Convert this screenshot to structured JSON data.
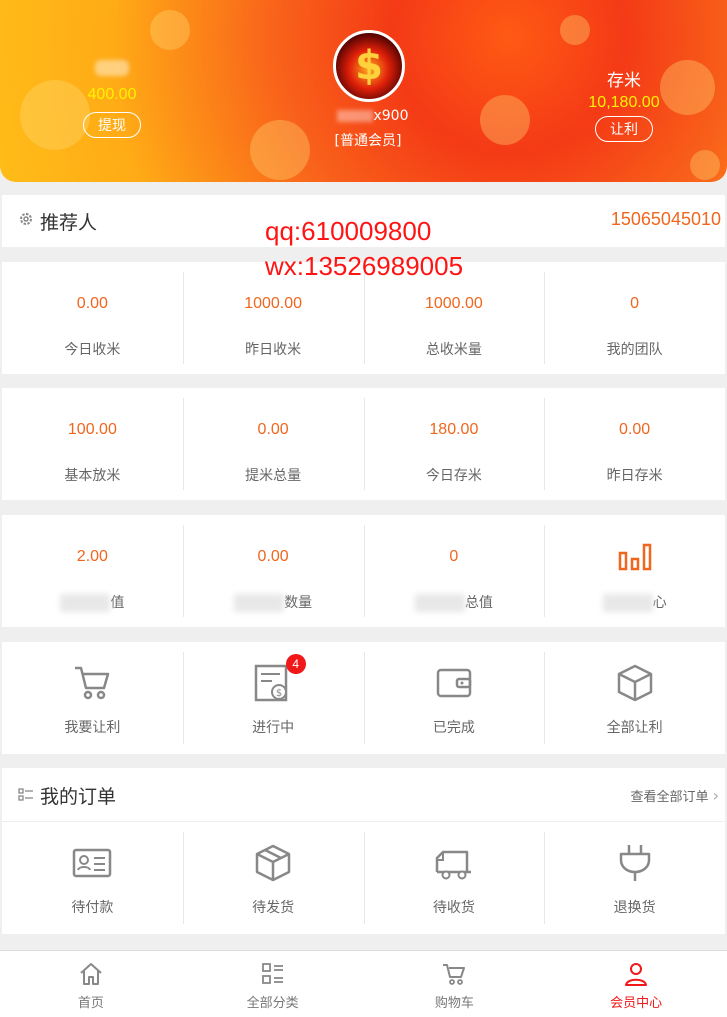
{
  "header": {
    "left": {
      "value": "400.00",
      "button": "提现"
    },
    "right": {
      "label": "存米",
      "value": "10,180.00",
      "button": "让利"
    },
    "avatar_glyph": "$",
    "user_suffix": "x900",
    "level": "[普通会员]"
  },
  "referrer": {
    "label": "推荐人",
    "phone": "15065045010"
  },
  "watermark": {
    "line1": "qq:610009800",
    "line2": "wx:13526989005"
  },
  "stats1": [
    {
      "value": "0.00",
      "label": "今日收米"
    },
    {
      "value": "1000.00",
      "label": "昨日收米"
    },
    {
      "value": "1000.00",
      "label": "总收米量"
    },
    {
      "value": "0",
      "label": "我的团队"
    }
  ],
  "stats2": [
    {
      "value": "100.00",
      "label": "基本放米"
    },
    {
      "value": "0.00",
      "label": "提米总量"
    },
    {
      "value": "180.00",
      "label": "今日存米"
    },
    {
      "value": "0.00",
      "label": "昨日存米"
    }
  ],
  "stats3": [
    {
      "value": "2.00",
      "label": "值"
    },
    {
      "value": "0.00",
      "label": "数量"
    },
    {
      "value": "0",
      "label": "总值"
    },
    {
      "label": "心"
    }
  ],
  "actions": [
    {
      "label": "我要让利",
      "icon": "cart-icon"
    },
    {
      "label": "进行中",
      "icon": "in-progress-icon",
      "badge": "4"
    },
    {
      "label": "已完成",
      "icon": "wallet-icon"
    },
    {
      "label": "全部让利",
      "icon": "box-icon"
    }
  ],
  "orders": {
    "title": "我的订单",
    "view_all": "查看全部订单",
    "items": [
      {
        "label": "待付款",
        "icon": "id-card-icon"
      },
      {
        "label": "待发货",
        "icon": "package-icon"
      },
      {
        "label": "待收货",
        "icon": "truck-icon"
      },
      {
        "label": "退换货",
        "icon": "plug-icon"
      }
    ]
  },
  "tabbar": [
    {
      "label": "首页",
      "icon": "home-icon"
    },
    {
      "label": "全部分类",
      "icon": "category-icon"
    },
    {
      "label": "购物车",
      "icon": "cart-icon"
    },
    {
      "label": "会员中心",
      "icon": "user-icon",
      "active": true
    }
  ],
  "colors": {
    "accent": "#f0661e",
    "active": "#f01818",
    "highlight": "#fff200"
  }
}
